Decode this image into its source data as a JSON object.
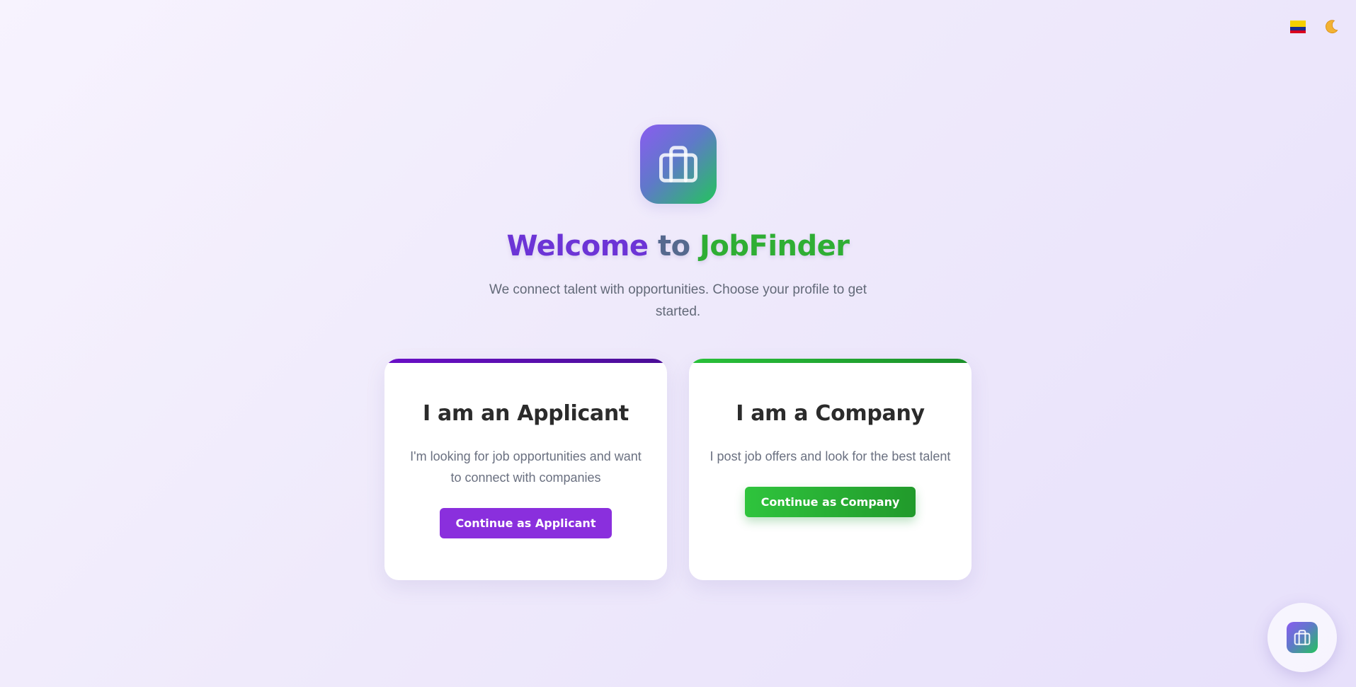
{
  "header": {
    "language_flag_icon": "colombia-flag-icon",
    "theme_toggle_icon": "moon-icon"
  },
  "hero": {
    "logo_icon": "briefcase-icon",
    "title_part1": "Welcome",
    "title_part2": "to",
    "title_part3": "JobFinder",
    "subtitle": "We connect talent with opportunities. Choose your profile to get started."
  },
  "cards": {
    "applicant": {
      "title": "I am an Applicant",
      "description": "I'm looking for job opportunities and want to connect with companies",
      "button_label": "Continue as Applicant",
      "accent_color": "#8a2fdd"
    },
    "company": {
      "title": "I am a Company",
      "description": "I post job offers and look for the best talent",
      "button_label": "Continue as Company",
      "accent_color": "#2fae34"
    }
  },
  "fab": {
    "icon": "briefcase-icon"
  },
  "colors": {
    "brand_purple": "#6c34d6",
    "brand_green": "#2fae34",
    "background": "#f2eefd"
  }
}
